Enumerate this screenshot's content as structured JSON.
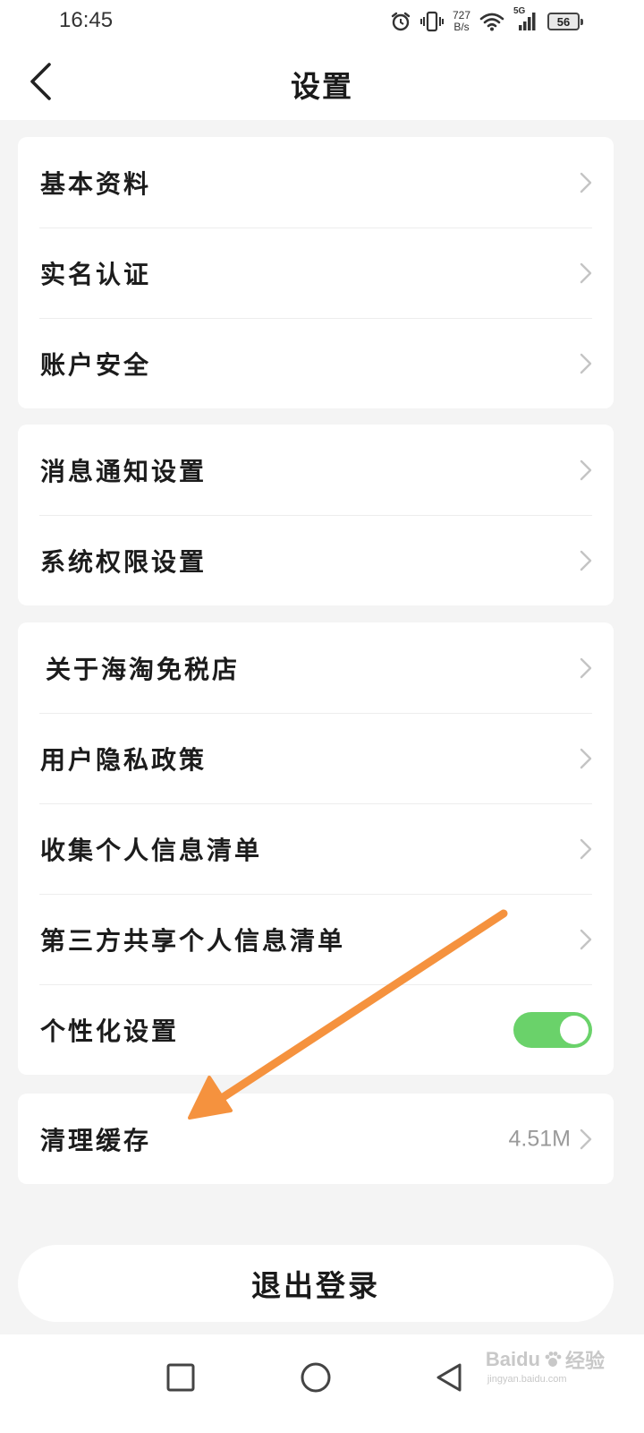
{
  "status_bar": {
    "time": "16:45",
    "net_speed_value": "727",
    "net_speed_unit": "B/s",
    "network_type": "5G",
    "battery_level": "56"
  },
  "header": {
    "title": "设置"
  },
  "groups": [
    {
      "items": [
        {
          "label": "基本资料"
        },
        {
          "label": "实名认证"
        },
        {
          "label": "账户安全"
        }
      ]
    },
    {
      "items": [
        {
          "label": "消息通知设置"
        },
        {
          "label": "系统权限设置"
        }
      ]
    },
    {
      "items": [
        {
          "label": "关于海淘免税店"
        },
        {
          "label": "用户隐私政策"
        },
        {
          "label": "收集个人信息清单"
        },
        {
          "label": "第三方共享个人信息清单"
        },
        {
          "label": "个性化设置",
          "toggle_on": true
        }
      ]
    },
    {
      "items": [
        {
          "label": "清理缓存",
          "value": "4.51M"
        }
      ]
    }
  ],
  "logout_label": "退出登录",
  "watermark": {
    "brand": "Baidu",
    "suffix": "经验",
    "url": "jingyan.baidu.com"
  },
  "colors": {
    "toggle_on": "#6ad26a",
    "annotation_arrow": "#f5923e",
    "page_background": "#f4f4f4"
  }
}
